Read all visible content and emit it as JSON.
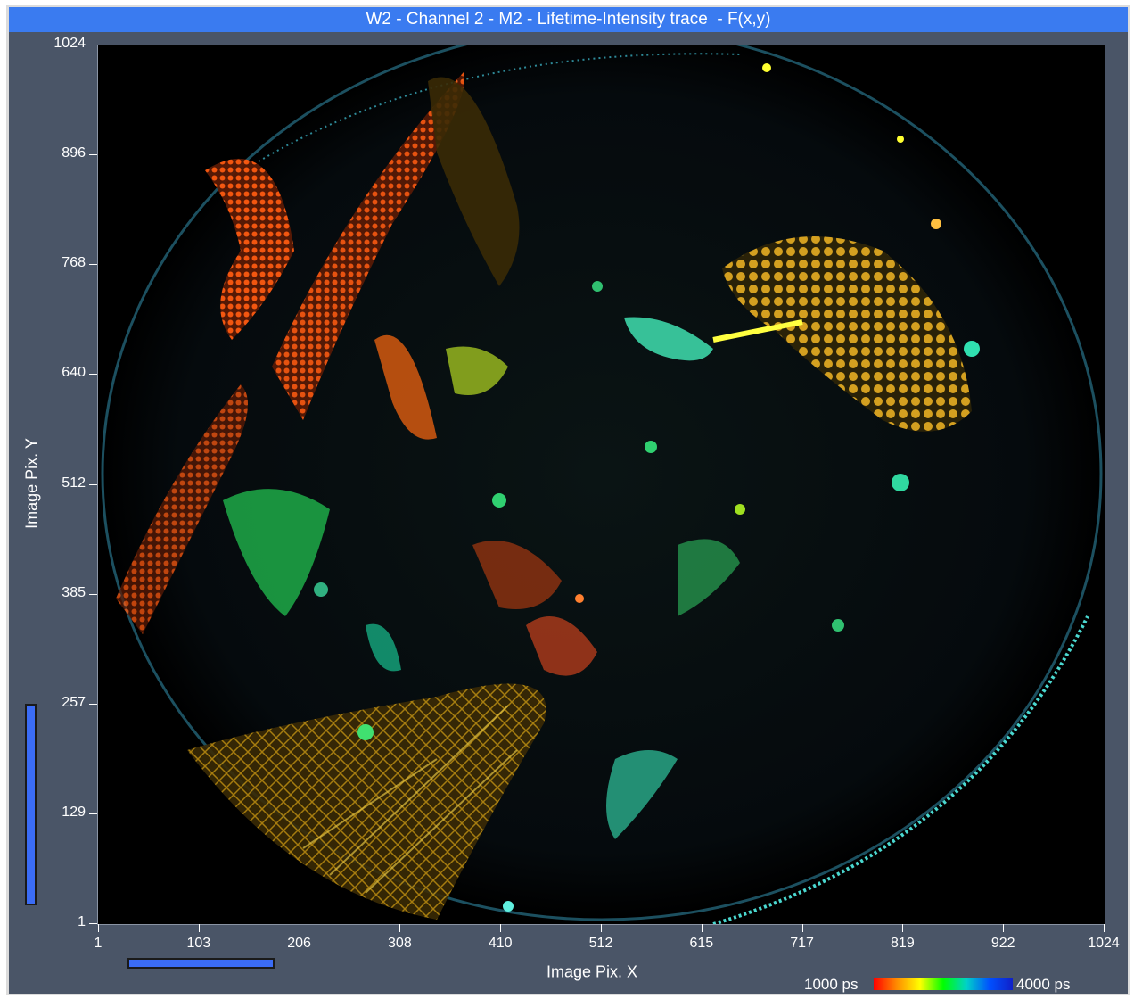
{
  "window": {
    "title": "W2 - Channel 2 - M2 - Lifetime-Intensity trace  - F(x,y)"
  },
  "axes": {
    "y_title": "Image Pix. Y",
    "x_title": "Image Pix. X",
    "y_ticks": [
      "1024",
      "896",
      "768",
      "640",
      "512",
      "385",
      "257",
      "129",
      "1"
    ],
    "x_ticks": [
      "1",
      "103",
      "206",
      "308",
      "410",
      "512",
      "615",
      "717",
      "819",
      "922",
      "1024"
    ]
  },
  "colorbar": {
    "min_label": "1000 ps",
    "max_label": "4000 ps",
    "colors": [
      "#ff0000",
      "#ff8c00",
      "#ffff00",
      "#00ff00",
      "#00d2c8",
      "#0050ff",
      "#1020c8"
    ]
  },
  "image": {
    "description_icon": "flim-image"
  },
  "colors": {
    "title_bar": "#3a7bf0",
    "panel": "#4a5567",
    "scrollbar": "#3b6cf5"
  }
}
